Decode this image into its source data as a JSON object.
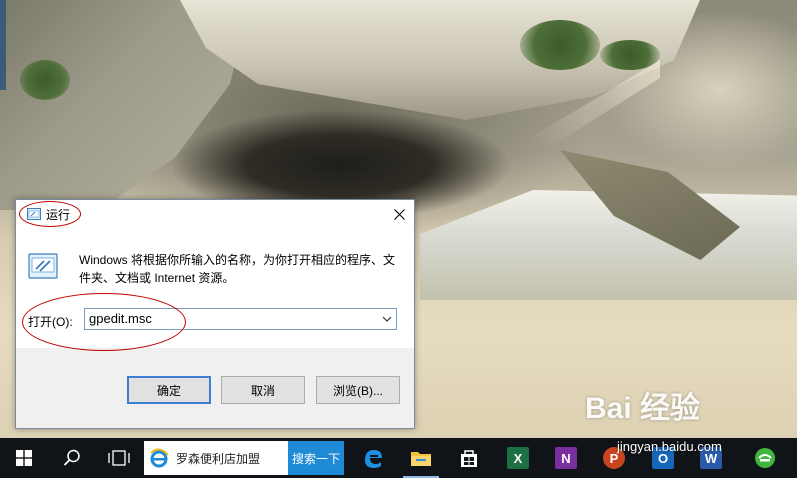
{
  "dialog": {
    "title": "运行",
    "description": "Windows 将根据你所输入的名称，为你打开相应的程序、文件夹、文档或 Internet 资源。",
    "open_label": "打开(O):",
    "input_value": "gpedit.msc",
    "buttons": {
      "ok": "确定",
      "cancel": "取消",
      "browse": "浏览(B)..."
    }
  },
  "taskbar": {
    "search_text": "罗森便利店加盟",
    "search_button": "搜索一下",
    "apps": {
      "excel": "X",
      "onenote": "N",
      "powerpoint": "P",
      "outlook": "O",
      "word": "W"
    }
  },
  "watermark": {
    "logo_text": "Bai  经验",
    "url": "jingyan.baidu.com"
  },
  "colors": {
    "taskbar": "#101318",
    "accent": "#1f8ad6",
    "annotation": "#c00000",
    "primary_button_border": "#3c7fd1"
  },
  "icons": [
    "run-icon",
    "close-icon",
    "chevron-down-icon",
    "windows-start-icon",
    "search-icon",
    "task-view-icon",
    "ie-icon",
    "edge-icon",
    "file-explorer-icon",
    "store-icon",
    "excel-icon",
    "onenote-icon",
    "powerpoint-icon",
    "outlook-icon",
    "word-icon",
    "360-browser-icon"
  ]
}
